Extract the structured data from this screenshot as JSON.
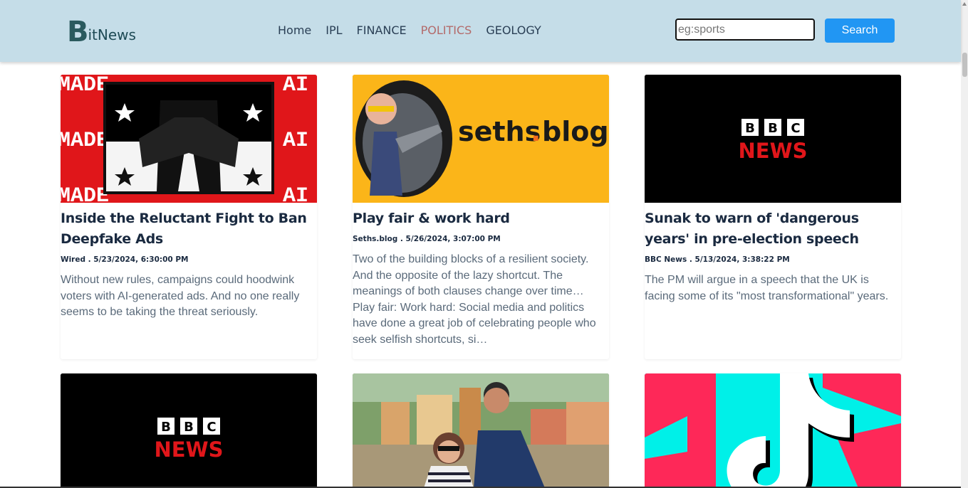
{
  "header": {
    "logo_big": "B",
    "logo_rest": "itNews",
    "nav": [
      "Home",
      "IPL",
      "FINANCE",
      "POLITICS",
      "GEOLOGY"
    ],
    "active_nav": "POLITICS",
    "search_placeholder": "eg:sports",
    "search_button": "Search"
  },
  "articles": [
    {
      "title": "Inside the Reluctant Fight to Ban Deepfake Ads",
      "meta": "Wired . 5/23/2024, 6:30:00 PM",
      "description": "Without new rules, campaigns could hoodwink voters with AI-generated ads. And no one really seems to be taking the threat seriously.",
      "image_text": [
        "MADE",
        "AI"
      ]
    },
    {
      "title": "Play fair & work hard",
      "meta": "Seths.blog . 5/26/2024, 3:07:00 PM",
      "description": "Two of the building blocks of a resilient society. And the opposite of the lazy shortcut. The meanings of both clauses change over time… Play fair: Work hard: Social media and politics have done a great job of celebrating people who seek selfish shortcuts, si…",
      "image_text": [
        "seths",
        ".",
        "blog"
      ]
    },
    {
      "title": "Sunak to warn of 'dangerous years' in pre-election speech",
      "meta": "BBC News . 5/13/2024, 3:38:22 PM",
      "description": "The PM will argue in a speech that the UK is facing some of its \"most transformational\" years.",
      "image_text": [
        "B",
        "B",
        "C",
        "NEWS"
      ]
    },
    {
      "title": "",
      "meta": "",
      "description": "",
      "image_text": [
        "B",
        "B",
        "C",
        "NEWS"
      ]
    },
    {
      "title": "",
      "meta": "",
      "description": "",
      "image_text": []
    },
    {
      "title": "",
      "meta": "",
      "description": "",
      "image_text": []
    }
  ],
  "colors": {
    "header_bg": "#c5dde8",
    "active_nav": "#b36a6a",
    "search_button_bg": "#2196f3",
    "bbc_red": "#e0161a",
    "seths_yellow": "#fbb519"
  }
}
